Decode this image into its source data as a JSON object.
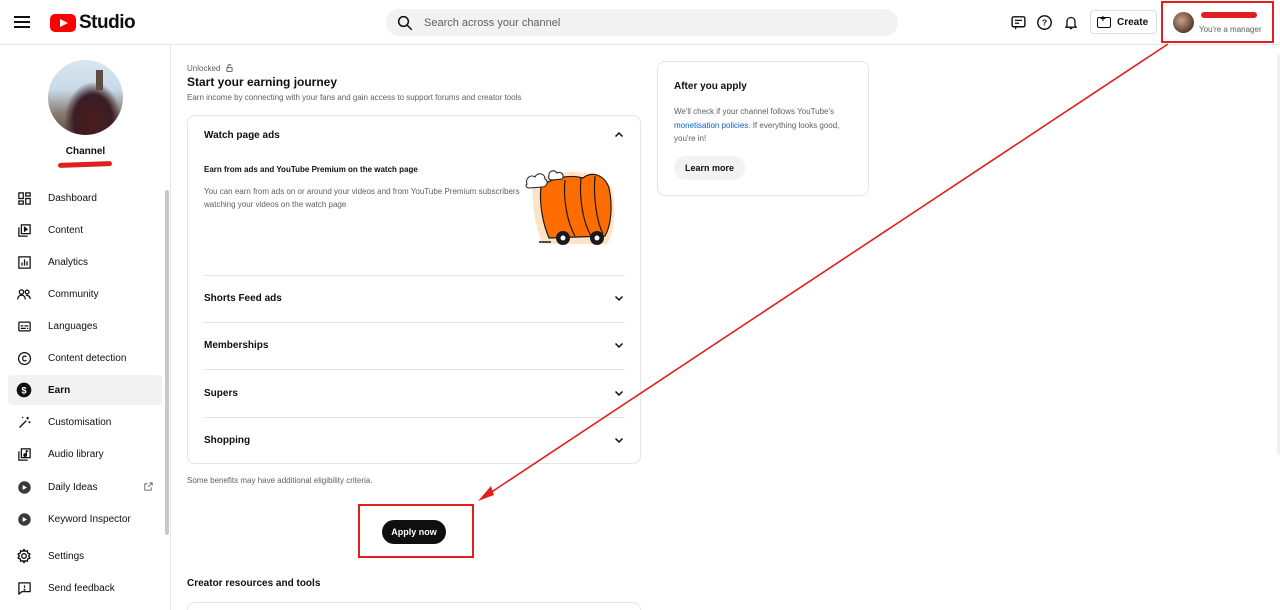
{
  "header": {
    "brand": "Studio",
    "search_placeholder": "Search across your channel",
    "create_label": "Create",
    "account_role": "You're a manager"
  },
  "sidebar": {
    "channel_label": "Channel",
    "items": [
      {
        "label": "Dashboard",
        "icon": "dashboard-icon"
      },
      {
        "label": "Content",
        "icon": "content-icon"
      },
      {
        "label": "Analytics",
        "icon": "analytics-icon"
      },
      {
        "label": "Community",
        "icon": "community-icon"
      },
      {
        "label": "Languages",
        "icon": "subtitles-icon"
      },
      {
        "label": "Content detection",
        "icon": "copyright-icon"
      },
      {
        "label": "Earn",
        "icon": "dollar-icon",
        "active": true
      },
      {
        "label": "Customisation",
        "icon": "magic-wand-icon"
      },
      {
        "label": "Audio library",
        "icon": "audio-library-icon"
      },
      {
        "label": "Daily Ideas",
        "icon": "extension-icon",
        "external": true
      },
      {
        "label": "Keyword Inspector",
        "icon": "extension-icon"
      },
      {
        "label": "Settings",
        "icon": "gear-icon"
      },
      {
        "label": "Send feedback",
        "icon": "feedback-icon"
      }
    ]
  },
  "main": {
    "unlocked_label": "Unlocked",
    "title": "Start your earning journey",
    "subtitle": "Earn income by connecting with your fans and gain access to support forums and creator tools",
    "accordion": [
      {
        "title": "Watch page ads",
        "expanded": true,
        "heading": "Earn from ads and YouTube Premium on the watch page",
        "description": "You can earn from ads on or around your videos and from YouTube Premium subscribers watching your videos on the watch page"
      },
      {
        "title": "Shorts Feed ads",
        "expanded": false
      },
      {
        "title": "Memberships",
        "expanded": false
      },
      {
        "title": "Supers",
        "expanded": false
      },
      {
        "title": "Shopping",
        "expanded": false
      }
    ],
    "eligibility_note": "Some benefits may have additional eligibility criteria.",
    "apply_label": "Apply now",
    "resources_title": "Creator resources and tools"
  },
  "side_card": {
    "title": "After you apply",
    "text_before": "We'll check if your channel follows YouTube's ",
    "link": "monetisation policies",
    "text_after": ". If everything looks good, you're in!",
    "button": "Learn more"
  },
  "colors": {
    "brand_red": "#ff0000",
    "annotation_red": "#e02020",
    "link_blue": "#065fd4",
    "illustration_orange": "#ff6d00"
  }
}
